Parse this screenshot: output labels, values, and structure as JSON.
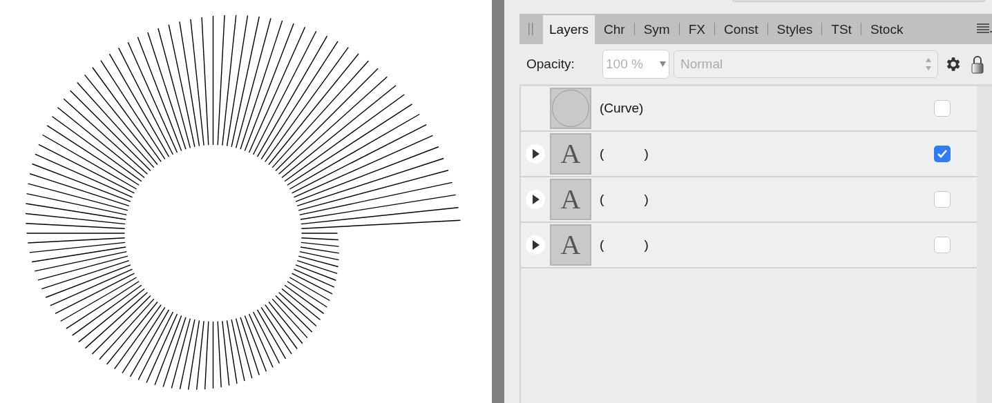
{
  "tabs": [
    {
      "label": "Layers",
      "selected": true
    },
    {
      "label": "Chr",
      "selected": false
    },
    {
      "label": "Sym",
      "selected": false
    },
    {
      "label": "FX",
      "selected": false
    },
    {
      "label": "Const",
      "selected": false
    },
    {
      "label": "Styles",
      "selected": false
    },
    {
      "label": "TSt",
      "selected": false
    },
    {
      "label": "Stock",
      "selected": false
    }
  ],
  "toolbar": {
    "opacity_label": "Opacity:",
    "opacity_value": "100 %",
    "blend_mode": "Normal"
  },
  "layers": [
    {
      "kind": "curve",
      "name": "(Curve)",
      "expandable": false,
      "checked": false
    },
    {
      "kind": "text",
      "thumbnail_text": "A",
      "name": "(           )",
      "expandable": true,
      "checked": true
    },
    {
      "kind": "text",
      "thumbnail_text": "A",
      "name": "(           )",
      "expandable": true,
      "checked": false
    },
    {
      "kind": "text",
      "thumbnail_text": "A",
      "name": "(           )",
      "expandable": true,
      "checked": false
    }
  ]
}
